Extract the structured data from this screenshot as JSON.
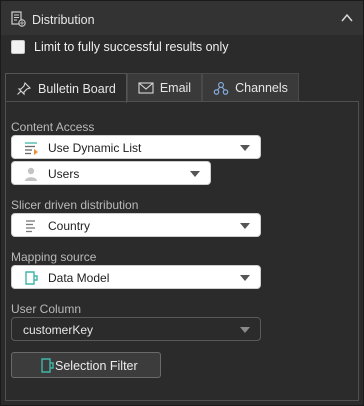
{
  "header": {
    "title": "Distribution"
  },
  "options": {
    "limit_label": "Limit to fully successful results only",
    "limit_checked": false
  },
  "tabs": [
    {
      "label": "Bulletin Board",
      "active": true
    },
    {
      "label": "Email",
      "active": false
    },
    {
      "label": "Channels",
      "active": false
    }
  ],
  "content_access": {
    "label": "Content Access",
    "list_value": "Use Dynamic List",
    "users_value": "Users"
  },
  "slicer": {
    "label": "Slicer driven distribution",
    "value": "Country"
  },
  "mapping": {
    "label": "Mapping source",
    "value": "Data Model"
  },
  "user_column": {
    "label": "User Column",
    "value": "customerKey"
  },
  "filter_button": {
    "label": "Selection Filter"
  },
  "colors": {
    "accent_teal": "#3fb6a8",
    "accent_orange": "#e8913a",
    "panel_bg": "#2b2b2b"
  }
}
